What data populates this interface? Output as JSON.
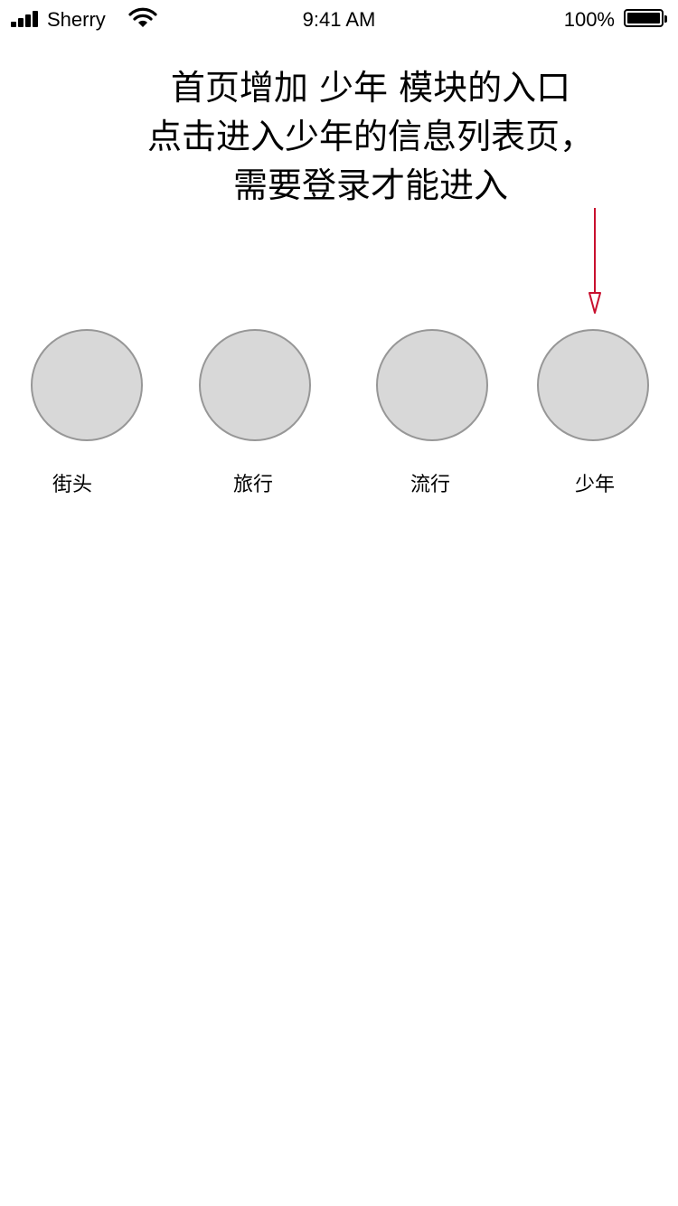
{
  "status_bar": {
    "carrier": "Sherry",
    "time": "9:41 AM",
    "battery_percent": "100%",
    "battery_level": 1.0,
    "signal_icon": "signal-bars-icon",
    "wifi_icon": "wifi-icon",
    "battery_icon": "battery-icon"
  },
  "annotation": {
    "lines": [
      "首页增加 少年 模块的入口",
      "点击进入少年的信息列表页，",
      "需要登录才能进入"
    ],
    "arrow_color": "#c8102e"
  },
  "entries": [
    {
      "label": "街头"
    },
    {
      "label": "旅行"
    },
    {
      "label": "流行"
    },
    {
      "label": "少年"
    }
  ],
  "colors": {
    "circle_fill": "#d8d8d8",
    "circle_border": "#979797"
  }
}
